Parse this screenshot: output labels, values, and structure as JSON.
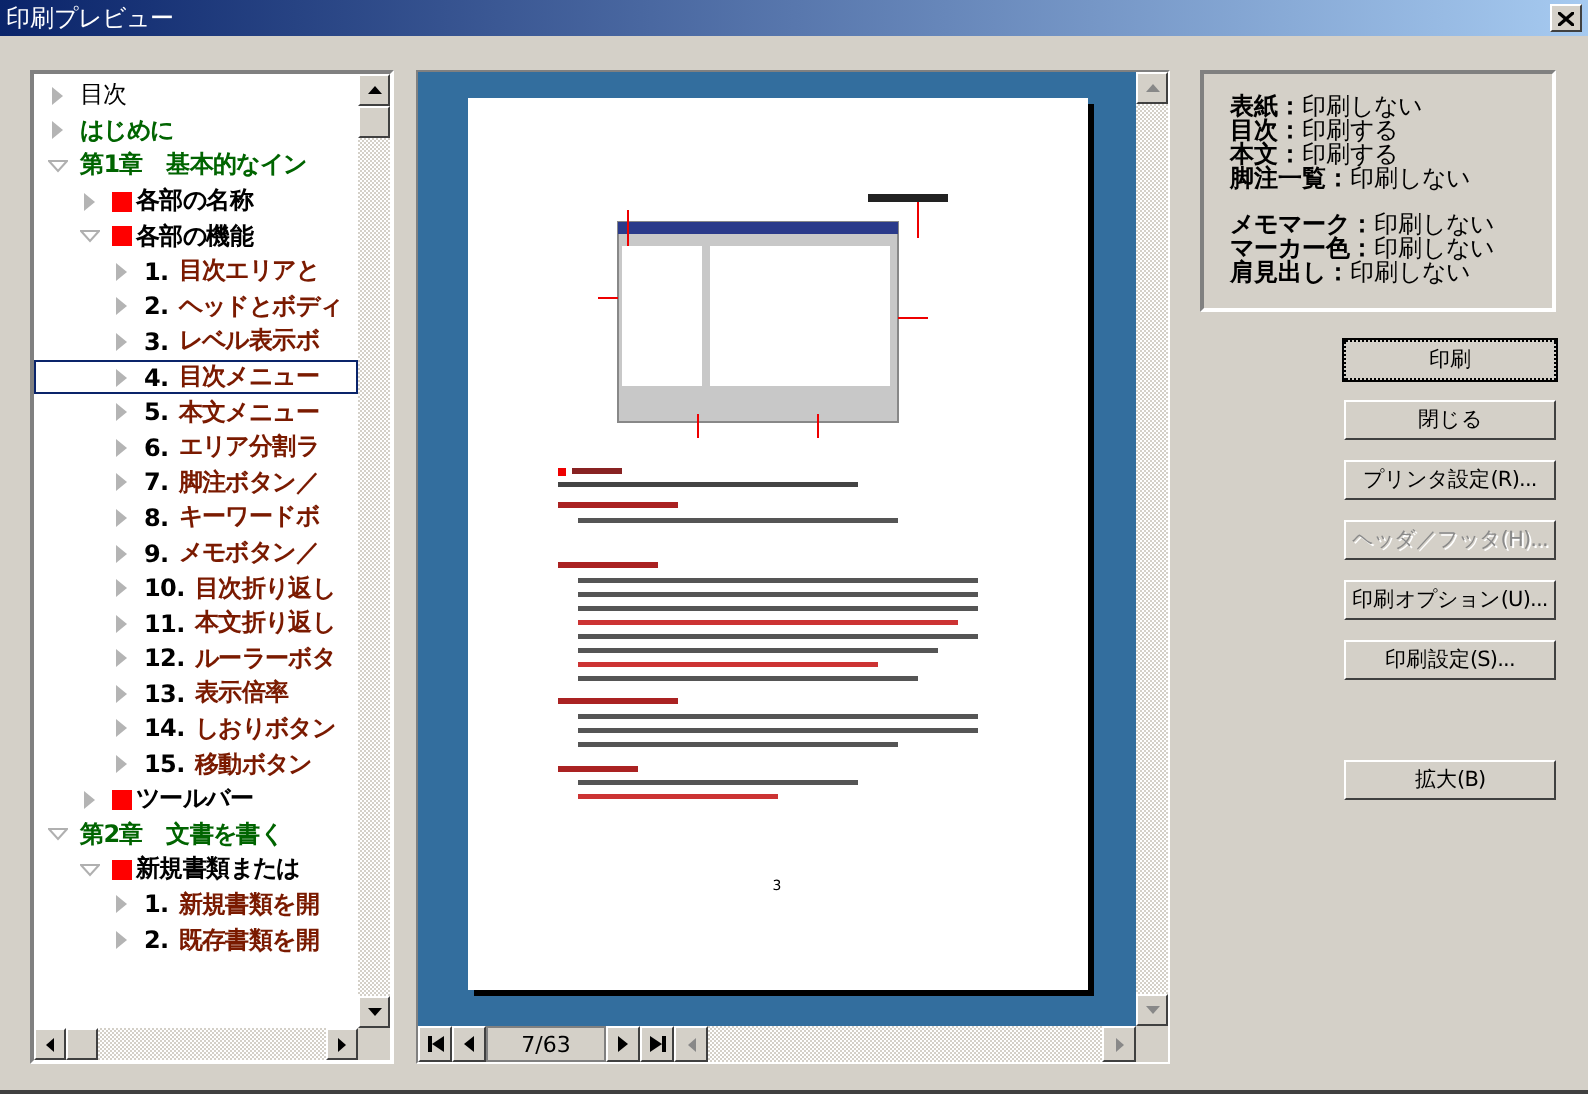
{
  "window": {
    "title": "印刷プレビュー"
  },
  "tree": [
    {
      "label": "目次",
      "kind": "plain",
      "expanded": false,
      "selected": false
    },
    {
      "label": "はじめに",
      "kind": "chapter",
      "expanded": false,
      "selected": false
    },
    {
      "label": "第1章　基本的なイン",
      "kind": "chapter",
      "expanded": true,
      "selected": false,
      "children": [
        {
          "label": "各部の名称",
          "kind": "section",
          "expanded": false,
          "selected": false
        },
        {
          "label": "各部の機能",
          "kind": "section",
          "expanded": true,
          "selected": false,
          "children": [
            {
              "number": "1.",
              "label": "目次エリアと",
              "kind": "topic",
              "expanded": false,
              "selected": false
            },
            {
              "number": "2.",
              "label": "ヘッドとボディ",
              "kind": "topic",
              "expanded": false,
              "selected": false
            },
            {
              "number": "3.",
              "label": "レベル表示ボ",
              "kind": "topic",
              "expanded": false,
              "selected": false
            },
            {
              "number": "4.",
              "label": "目次メニュー",
              "kind": "topic",
              "expanded": false,
              "selected": true
            },
            {
              "number": "5.",
              "label": "本文メニュー",
              "kind": "topic",
              "expanded": false,
              "selected": false
            },
            {
              "number": "6.",
              "label": "エリア分割ラ",
              "kind": "topic",
              "expanded": false,
              "selected": false
            },
            {
              "number": "7.",
              "label": "脚注ボタン／",
              "kind": "topic",
              "expanded": false,
              "selected": false
            },
            {
              "number": "8.",
              "label": "キーワードボ",
              "kind": "topic",
              "expanded": false,
              "selected": false
            },
            {
              "number": "9.",
              "label": "メモボタン／",
              "kind": "topic",
              "expanded": false,
              "selected": false
            },
            {
              "number": "10.",
              "label": "目次折り返し",
              "kind": "topic",
              "expanded": false,
              "selected": false
            },
            {
              "number": "11.",
              "label": "本文折り返し",
              "kind": "topic",
              "expanded": false,
              "selected": false
            },
            {
              "number": "12.",
              "label": "ルーラーボタ",
              "kind": "topic",
              "expanded": false,
              "selected": false
            },
            {
              "number": "13.",
              "label": "表示倍率",
              "kind": "topic",
              "expanded": false,
              "selected": false
            },
            {
              "number": "14.",
              "label": "しおりボタン",
              "kind": "topic",
              "expanded": false,
              "selected": false
            },
            {
              "number": "15.",
              "label": "移動ボタン",
              "kind": "topic",
              "expanded": false,
              "selected": false
            }
          ]
        },
        {
          "label": "ツールバー",
          "kind": "section",
          "expanded": false,
          "selected": false
        }
      ]
    },
    {
      "label": "第2章　文書を書く",
      "kind": "chapter",
      "expanded": true,
      "selected": false,
      "children": [
        {
          "label": "新規書類または",
          "kind": "section",
          "expanded": true,
          "selected": false,
          "children": [
            {
              "number": "1.",
              "label": "新規書類を開",
              "kind": "topic",
              "expanded": false,
              "selected": false
            },
            {
              "number": "2.",
              "label": "既存書類を開",
              "kind": "topic",
              "expanded": false,
              "selected": false
            }
          ]
        }
      ]
    }
  ],
  "preview": {
    "page_number": "3",
    "page_indicator": "7/63"
  },
  "settings": [
    [
      {
        "label": "表紙：",
        "value": "印刷しない"
      },
      {
        "label": "目次：",
        "value": "印刷する"
      },
      {
        "label": "本文：",
        "value": "印刷する"
      },
      {
        "label": "脚注一覧：",
        "value": "印刷しない"
      }
    ],
    [
      {
        "label": "メモマーク：",
        "value": "印刷しない"
      },
      {
        "label": "マーカー色：",
        "value": "印刷しない"
      },
      {
        "label": "肩見出し：",
        "value": "印刷しない"
      }
    ]
  ],
  "buttons": [
    {
      "label": "印刷",
      "disabled": false,
      "default": true
    },
    {
      "label": "閉じる",
      "disabled": false,
      "default": false
    },
    {
      "label": "プリンタ設定(R)...",
      "disabled": false,
      "default": false
    },
    {
      "label": "ヘッダ／フッタ(H)...",
      "disabled": true,
      "default": false
    },
    {
      "label": "印刷オプション(U)...",
      "disabled": false,
      "default": false
    },
    {
      "label": "印刷設定(S)...",
      "disabled": false,
      "default": false
    }
  ],
  "lower_buttons": [
    {
      "label": "拡大(B)",
      "disabled": false,
      "default": false
    }
  ]
}
